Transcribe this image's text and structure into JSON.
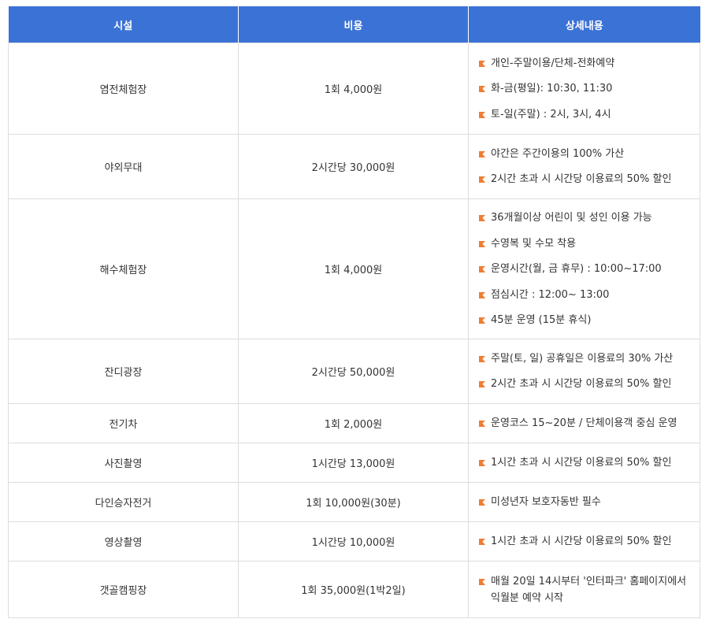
{
  "table": {
    "headers": [
      "시설",
      "비용",
      "상세내용"
    ],
    "bullet_color": "#ef7d33",
    "header_color": "#3b72d6",
    "rows": [
      {
        "facility": "염전체험장",
        "cost": "1회 4,000원",
        "details": [
          "개인-주말이용/단체-전화예약",
          "화-금(평일): 10:30, 11:30",
          "토-일(주말) : 2시, 3시, 4시"
        ]
      },
      {
        "facility": "야외무대",
        "cost": "2시간당 30,000원",
        "details": [
          "야간은 주간이용의 100% 가산",
          "2시간 초과 시 시간당 이용료의 50% 할인"
        ]
      },
      {
        "facility": "해수체험장",
        "cost": "1회 4,000원",
        "details": [
          "36개월이상 어린이 및 성인 이용 가능",
          "수영복 및 수모 착용",
          "운영시간(월, 금 휴무) : 10:00~17:00",
          "점심시간 : 12:00~ 13:00",
          "45분 운영 (15분 휴식)"
        ]
      },
      {
        "facility": "잔디광장",
        "cost": "2시간당 50,000원",
        "details": [
          "주말(토, 일) 공휴일은 이용료의 30% 가산",
          "2시간 초과 시 시간당 이용료의 50% 할인"
        ]
      },
      {
        "facility": "전기차",
        "cost": "1회 2,000원",
        "details": [
          "운영코스 15~20분 / 단체이용객 중심 운영"
        ]
      },
      {
        "facility": "사진촬영",
        "cost": "1시간당 13,000원",
        "details": [
          "1시간 초과 시 시간당 이용료의 50% 할인"
        ]
      },
      {
        "facility": "다인승자전거",
        "cost": "1회 10,000원(30분)",
        "details": [
          "미성년자 보호자동반 필수"
        ]
      },
      {
        "facility": "영상촬영",
        "cost": "1시간당 10,000원",
        "details": [
          "1시간 초과 시 시간당 이용료의 50% 할인"
        ]
      },
      {
        "facility": "갯골캠핑장",
        "cost": "1회 35,000원(1박2일)",
        "details": [
          "매월 20일 14시부터 '인터파크' 홈페이지에서 익월분 예약 시작"
        ]
      }
    ]
  }
}
